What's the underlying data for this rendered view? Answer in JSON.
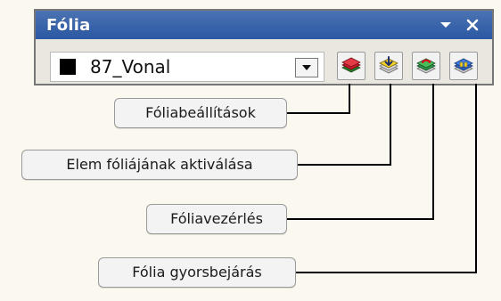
{
  "panel": {
    "title": "Fólia",
    "titlebar_buttons": [
      {
        "name": "panel-menu-button",
        "icon": "chevron-down-icon"
      },
      {
        "name": "panel-close-button",
        "icon": "close-icon"
      }
    ]
  },
  "layer_select": {
    "value": "87_Vonal",
    "swatch_color": "#000000",
    "dropdown_icon": "chevron-down-icon"
  },
  "tool_buttons": [
    {
      "name": "layer-settings-button",
      "icon": "layers-red-icon"
    },
    {
      "name": "activate-element-layer-button",
      "icon": "layers-yellow-activate-icon"
    },
    {
      "name": "layer-control-button",
      "icon": "layers-green-control-icon"
    },
    {
      "name": "layer-quick-browse-button",
      "icon": "layers-blue-browse-icon"
    }
  ],
  "callouts": [
    {
      "label": "Fóliabeállítások"
    },
    {
      "label": "Elem fóliájának aktiválása"
    },
    {
      "label": "Fóliavezérlés"
    },
    {
      "label": "Fólia gyorsbejárás"
    }
  ],
  "colors": {
    "titlebar": "#2a58a3",
    "background": "#fbf8ef"
  }
}
